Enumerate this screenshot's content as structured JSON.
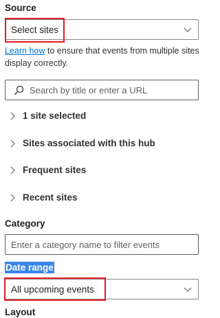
{
  "source": {
    "label": "Source",
    "dropdown_value": "Select sites",
    "help_link": "Learn how",
    "help_text": " to ensure that events from multiple sites display correctly."
  },
  "search": {
    "placeholder": "Search by title or enter a URL"
  },
  "tree_items": [
    {
      "label": "1 site selected"
    },
    {
      "label": "Sites associated with this hub"
    },
    {
      "label": "Frequent sites"
    },
    {
      "label": "Recent sites"
    }
  ],
  "category": {
    "label": "Category",
    "placeholder": "Enter a category name to filter events"
  },
  "date_range": {
    "label": "Date range",
    "dropdown_value": "All upcoming events"
  },
  "layout": {
    "label": "Layout"
  },
  "colors": {
    "highlight_border": "#e01b24",
    "link": "#0078d4",
    "selection": "#3a86e8"
  },
  "icons": {
    "dropdown": "chevron-down-icon",
    "search": "search-icon",
    "tree": "chevron-right-icon"
  }
}
